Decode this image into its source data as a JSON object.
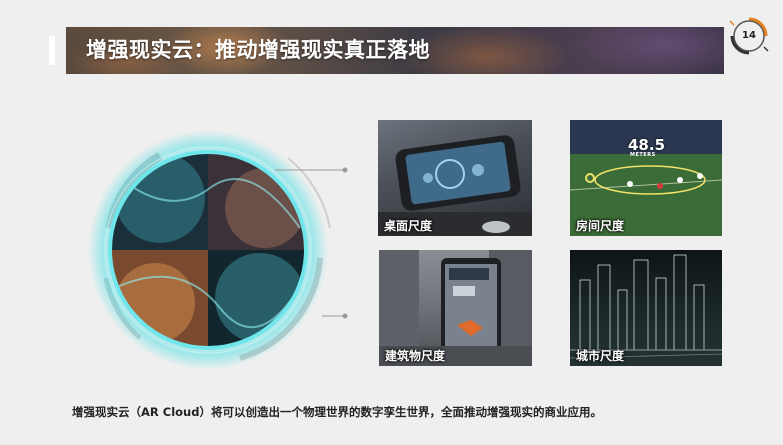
{
  "slide": {
    "title": "增强现实云：推动增强现实真正落地",
    "page_number": "14",
    "caption": "增强现实云（AR Cloud）将可以创造出一个物理世界的数字孪生世界，全面推动增强现实的商业应用。"
  },
  "scales": [
    {
      "label": "桌面尺度"
    },
    {
      "label": "房间尺度",
      "overlay_value": "48.5",
      "overlay_unit": "METERS"
    },
    {
      "label": "建筑物尺度"
    },
    {
      "label": "城市尺度"
    }
  ],
  "colors": {
    "background": "#efefef",
    "accent_orange": "#e0801e",
    "glow_cyan": "#5fe0e6"
  }
}
